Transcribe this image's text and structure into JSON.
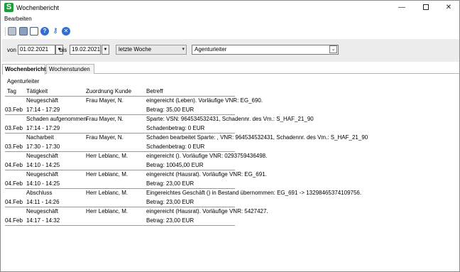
{
  "window": {
    "title": "Wochenbericht",
    "app_icon": "S",
    "minimize_glyph": "—",
    "close_glyph": "✕"
  },
  "menu": {
    "edit_label": "Bearbeiten"
  },
  "toolbar": {
    "help_glyph": "?",
    "key_glyph": "⚷",
    "close_glyph": "✕"
  },
  "filter": {
    "from_label": "von",
    "from_value": "01.02.2021",
    "to_label": "bis",
    "to_value": "19.02.2021",
    "dropdown_glyph": "▼",
    "period_value": "letzte Woche",
    "period_arrow": "▾",
    "user_value": "Agenturleiter",
    "user_arrow": "⌄"
  },
  "tabs": [
    {
      "label": "Wochenbericht",
      "active": true
    },
    {
      "label": "Wochenstunden",
      "active": false
    }
  ],
  "report": {
    "group": "Agenturleiter",
    "columns": {
      "tag": "Tag",
      "taetigkeit": "Tätigkeit",
      "kunde": "Zuordnung Kunde",
      "betreff": "Betreff"
    },
    "rows": [
      {
        "activity": "Neugeschäft",
        "date": "03.Feb",
        "time": "17:14  -  17:29",
        "customer": "Frau Mayer, N.",
        "subject1": "eingereicht (Leben). Vorläufige VNR: EG_690.",
        "subject2": "Betrag: 35,00 EUR"
      },
      {
        "activity": "Schaden aufgenommen",
        "date": "03.Feb",
        "time": "17:14  -  17:29",
        "customer": "Frau Mayer, N.",
        "subject1": "Sparte:  VSN: 964534532431, Schadennr. des Vm.: S_HAF_21_90",
        "subject2": "Schadenbetrag: 0 EUR"
      },
      {
        "activity": "Nacharbeit",
        "date": "03.Feb",
        "time": "17:30  -  17:30",
        "customer": "Frau Mayer, N.",
        "subject1": "Schaden bearbeitet Sparte: , VNR: 964534532431, Schadennr. des Vm.: S_HAF_21_90",
        "subject2": "Schadenbetrag: 0 EUR"
      },
      {
        "activity": "Neugeschäft",
        "date": "04.Feb",
        "time": "14:10  -  14:25",
        "customer": "Herr Leblanc, M.",
        "subject1": "eingereicht (). Vorläufige VNR: 0293759436498.",
        "subject2": "Betrag: 10045,00 EUR"
      },
      {
        "activity": "Neugeschäft",
        "date": "04.Feb",
        "time": "14:10  -  14:25",
        "customer": "Herr Leblanc, M.",
        "subject1": "eingereicht (Hausrat). Vorläufige VNR: EG_691.",
        "subject2": "Betrag: 23,00 EUR"
      },
      {
        "activity": "Abschluss",
        "date": "04.Feb",
        "time": "14:11  -  14:26",
        "customer": "Herr Leblanc, M.",
        "subject1": "Eingereichtes Geschäft () in Bestand übernommen: EG_691 -> 13298465374109756.",
        "subject2": "Betrag: 23,00 EUR"
      },
      {
        "activity": "Neugeschäft",
        "date": "04.Feb",
        "time": "14:17  -  14:32",
        "customer": "Herr Leblanc, M.",
        "subject1": "eingereicht (Hausrat). Vorläufige VNR: 5427427.",
        "subject2": "Betrag: 23,00 EUR"
      }
    ]
  }
}
